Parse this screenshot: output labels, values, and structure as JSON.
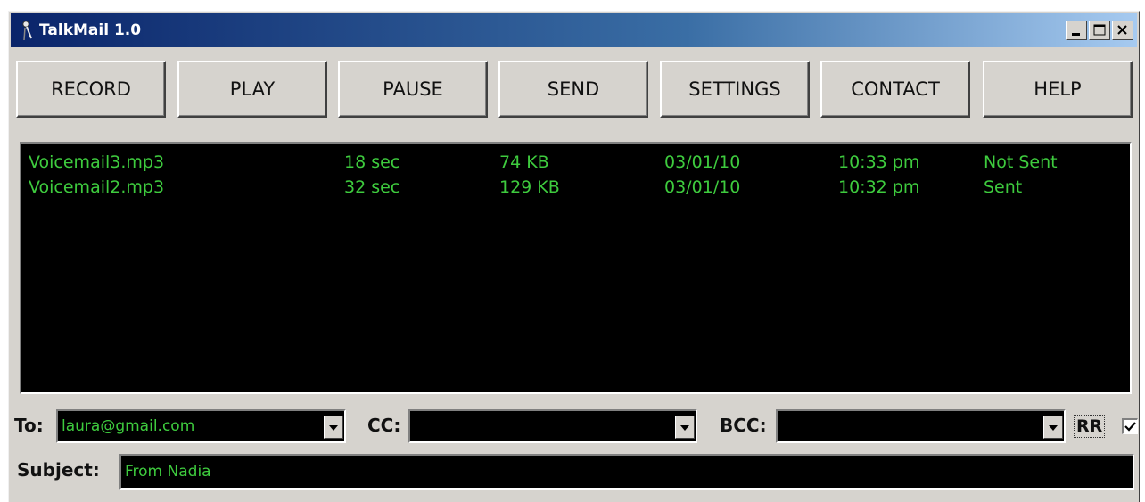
{
  "window": {
    "title": "TalkMail 1.0"
  },
  "toolbar": {
    "buttons": [
      {
        "label": "RECORD",
        "icon": ""
      },
      {
        "label": "PLAY",
        "icon": ""
      },
      {
        "label": "PAUSE",
        "icon": ""
      },
      {
        "label": "SEND",
        "icon": ""
      },
      {
        "label": "SETTINGS",
        "icon": ""
      },
      {
        "label": "CONTACT",
        "icon": ""
      },
      {
        "label": "HELP",
        "icon": ""
      }
    ]
  },
  "messages": {
    "rows": [
      {
        "file": "Voicemail3.mp3",
        "duration": "18 sec",
        "size": "74 KB",
        "date": "03/01/10",
        "time": "10:33 pm",
        "status": "Not Sent"
      },
      {
        "file": "Voicemail2.mp3",
        "duration": "32 sec",
        "size": "129 KB",
        "date": "03/01/10",
        "time": "10:32 pm",
        "status": "Sent"
      }
    ]
  },
  "compose": {
    "to_label": "To:",
    "to_value": "laura@gmail.com",
    "cc_label": "CC:",
    "cc_value": "",
    "bcc_label": "BCC:",
    "bcc_value": "",
    "rr_label": "RR",
    "rr_checked": true,
    "subject_label": "Subject:",
    "subject_value": "From Nadia"
  },
  "colors": {
    "text_green": "#3ecb3e",
    "list_background": "#000000",
    "window_face": "#d6d3ce",
    "title_start": "#0a246a",
    "title_end": "#a6caf0"
  },
  "icons": {
    "app": "microphone-icon",
    "minimize": "minimize-icon",
    "maximize": "maximize-icon",
    "close": "close-icon",
    "dropdown": "chevron-down-icon",
    "checkbox": "checkmark-icon"
  }
}
